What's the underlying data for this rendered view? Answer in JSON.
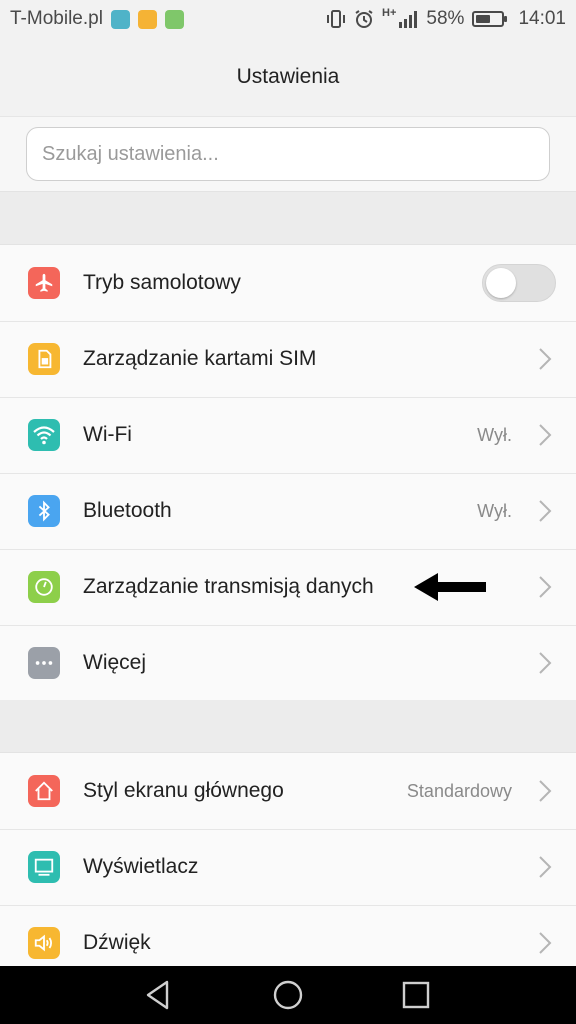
{
  "status_bar": {
    "carrier": "T-Mobile.pl",
    "network": "H+",
    "battery_percent": "58%",
    "battery_level": 0.58,
    "time": "14:01",
    "icons": [
      "gallery-notif-icon",
      "shopping-notif-icon",
      "app-notif-icon",
      "vibrate-icon",
      "alarm-icon",
      "signal-icon",
      "battery-icon"
    ]
  },
  "header": {
    "title": "Ustawienia"
  },
  "search": {
    "placeholder": "Szukaj ustawienia..."
  },
  "group1": {
    "items": [
      {
        "label": "Tryb samolotowy",
        "icon": "airplane-icon",
        "color": "#f4665a",
        "control": "toggle",
        "toggle_on": false
      },
      {
        "label": "Zarządzanie kartami SIM",
        "icon": "sim-card-icon",
        "color": "#f7b731",
        "control": "chevron"
      },
      {
        "label": "Wi-Fi",
        "icon": "wifi-icon",
        "color": "#2ebdb0",
        "value": "Wył.",
        "control": "chevron"
      },
      {
        "label": "Bluetooth",
        "icon": "bluetooth-icon",
        "color": "#4aa5f0",
        "value": "Wył.",
        "control": "chevron"
      },
      {
        "label": "Zarządzanie transmisją danych",
        "icon": "data-usage-icon",
        "color": "#8dcf4a",
        "control": "chevron",
        "annotation": "arrow-left"
      },
      {
        "label": "Więcej",
        "icon": "more-icon",
        "color": "#9ba0a8",
        "control": "chevron"
      }
    ]
  },
  "group2": {
    "items": [
      {
        "label": "Styl ekranu głównego",
        "icon": "home-style-icon",
        "color": "#f4665a",
        "value": "Standardowy",
        "control": "chevron"
      },
      {
        "label": "Wyświetlacz",
        "icon": "display-icon",
        "color": "#2ebdb0",
        "control": "chevron"
      },
      {
        "label": "Dźwięk",
        "icon": "sound-icon",
        "color": "#f7b731",
        "control": "chevron"
      }
    ]
  },
  "nav": {
    "buttons": [
      "back-icon",
      "home-icon",
      "recents-icon"
    ]
  }
}
